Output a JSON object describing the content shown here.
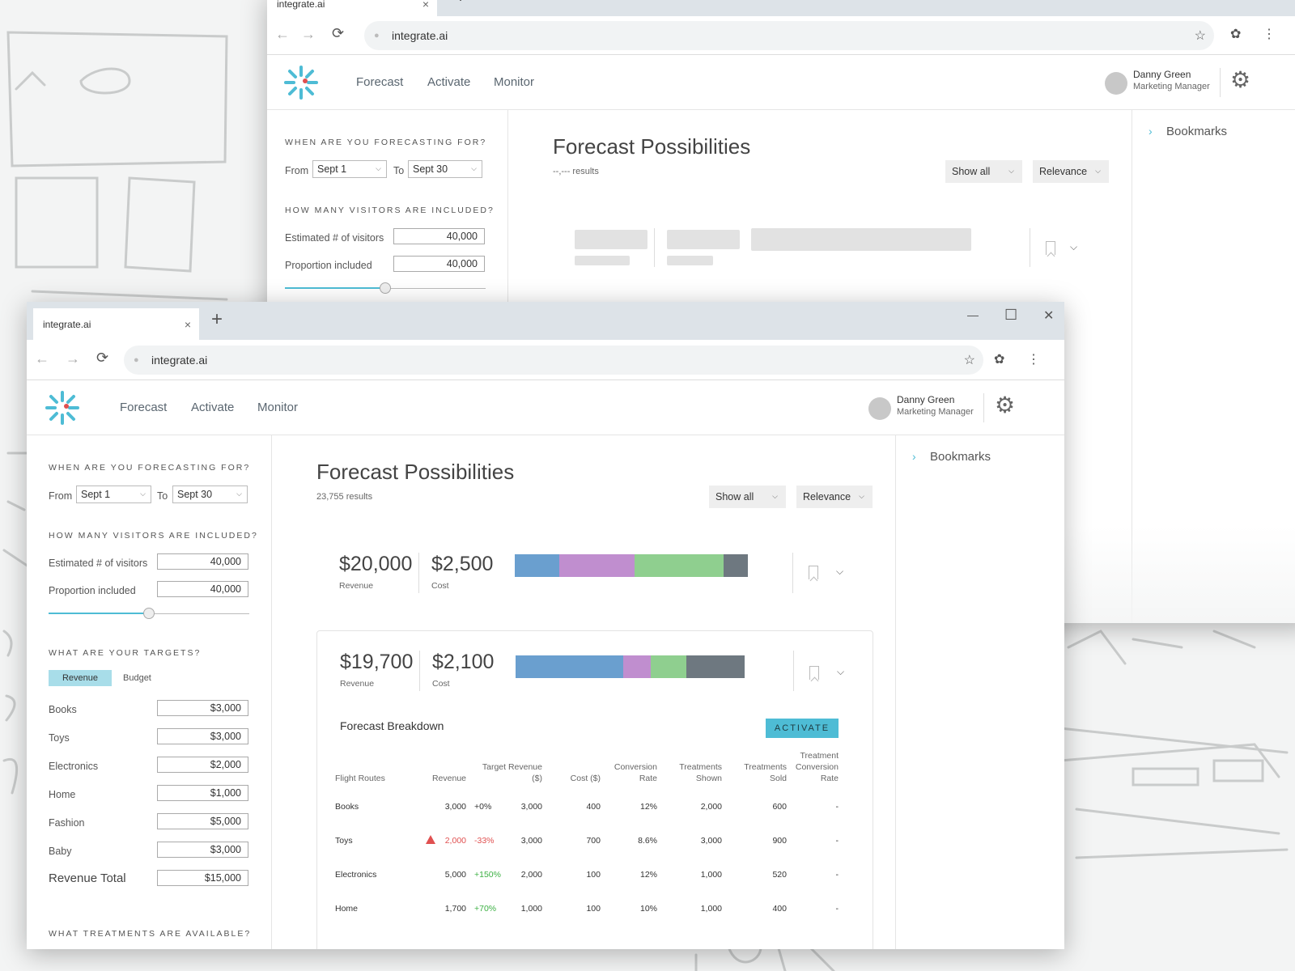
{
  "tab": {
    "title": "integrate.ai",
    "new_tab": "+",
    "close": "×"
  },
  "browser": {
    "url": "integrate.ai"
  },
  "window_controls": {
    "minimize": "—",
    "maximize": "☐",
    "close": "✕"
  },
  "nav": {
    "forecast": "Forecast",
    "activate": "Activate",
    "monitor": "Monitor"
  },
  "user": {
    "name": "Danny Green",
    "role": "Marketing Manager"
  },
  "sidebar": {
    "when_heading": "WHEN ARE YOU FORECASTING FOR?",
    "from_label": "From",
    "from_value": "Sept 1",
    "to_label": "To",
    "to_value": "Sept 30",
    "visitors_heading": "HOW MANY VISITORS ARE INCLUDED?",
    "estimated_label": "Estimated # of visitors",
    "estimated_value": "40,000",
    "proportion_label": "Proportion included",
    "proportion_value": "40,000",
    "slider_fraction": 0.5,
    "targets_heading": "WHAT ARE YOUR TARGETS?",
    "seg_revenue": "Revenue",
    "seg_budget": "Budget",
    "targets": [
      {
        "label": "Books",
        "value": "$3,000"
      },
      {
        "label": "Toys",
        "value": "$3,000"
      },
      {
        "label": "Electronics",
        "value": "$2,000"
      },
      {
        "label": "Home",
        "value": "$1,000"
      },
      {
        "label": "Fashion",
        "value": "$5,000"
      },
      {
        "label": "Baby",
        "value": "$3,000"
      }
    ],
    "total_label": "Revenue Total",
    "total_value": "$15,000",
    "treatments_heading": "WHAT TREATMENTS ARE AVAILABLE?"
  },
  "main": {
    "title": "Forecast Possibilities",
    "results": "23,755 results",
    "back_results": "--,--- results",
    "show_all": "Show all",
    "relevance": "Relevance",
    "cards": [
      {
        "revenue": "$20,000",
        "revenue_label": "Revenue",
        "cost": "$2,500",
        "cost_label": "Cost",
        "segments": [
          {
            "w": 0.19,
            "color": "#6a9fcf"
          },
          {
            "w": 0.325,
            "color": "#c08ecf"
          },
          {
            "w": 0.38,
            "color": "#8fcf8f"
          },
          {
            "w": 0.105,
            "color": "#6e7880"
          }
        ]
      },
      {
        "revenue": "$19,700",
        "revenue_label": "Revenue",
        "cost": "$2,100",
        "cost_label": "Cost",
        "segments": [
          {
            "w": 0.47,
            "color": "#6a9fcf"
          },
          {
            "w": 0.12,
            "color": "#c08ecf"
          },
          {
            "w": 0.155,
            "color": "#8fcf8f"
          },
          {
            "w": 0.255,
            "color": "#6e7880"
          }
        ]
      }
    ],
    "breakdown_title": "Forecast Breakdown",
    "activate": "ACTIVATE",
    "columns": [
      "Flight Routes",
      "Revenue",
      "Target Revenue ($)",
      "Cost ($)",
      "Conversion Rate",
      "Treatments Shown",
      "Treatments Sold",
      "Treatment Conversion Rate"
    ],
    "rows": [
      {
        "route": "Books",
        "revenue": "3,000",
        "delta": "+0%",
        "target": "3,000",
        "cost": "400",
        "conv": "12%",
        "shown": "2,000",
        "sold": "600",
        "tconv": "-"
      },
      {
        "route": "Toys",
        "revenue": "2,000",
        "delta": "-33%",
        "target": "3,000",
        "cost": "700",
        "conv": "8.6%",
        "shown": "3,000",
        "sold": "900",
        "tconv": "-"
      },
      {
        "route": "Electronics",
        "revenue": "5,000",
        "delta": "+150%",
        "target": "2,000",
        "cost": "100",
        "conv": "12%",
        "shown": "1,000",
        "sold": "520",
        "tconv": "-"
      },
      {
        "route": "Home",
        "revenue": "1,700",
        "delta": "+70%",
        "target": "1,000",
        "cost": "100",
        "conv": "10%",
        "shown": "1,000",
        "sold": "400",
        "tconv": "-"
      }
    ]
  },
  "bookmarks": {
    "label": "Bookmarks"
  },
  "colors": {
    "accent": "#4ebcd5",
    "negative": "#e05050",
    "positive": "#3cb043"
  }
}
